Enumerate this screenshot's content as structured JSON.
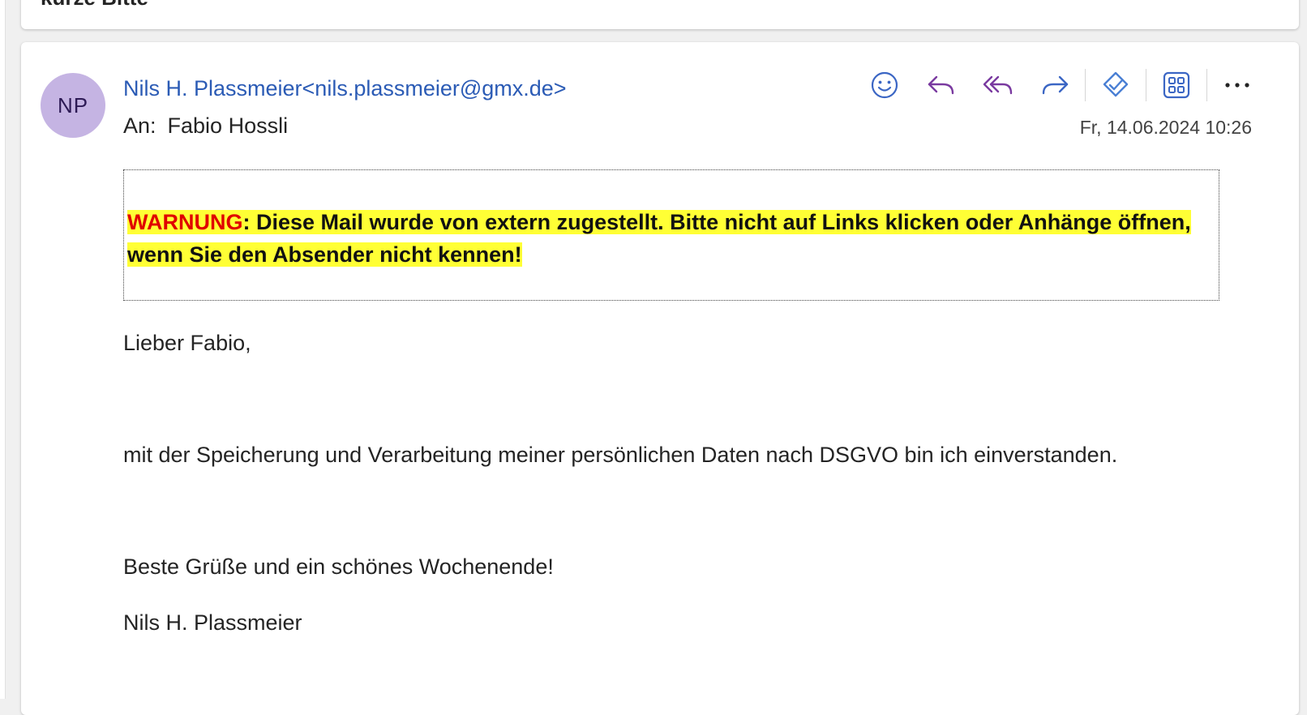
{
  "subject": "kurze Bitte",
  "message": {
    "avatar_initials": "NP",
    "sender": "Nils H. Plassmeier<nils.plassmeier@gmx.de>",
    "to_label": "An:",
    "to_name": "Fabio Hossli",
    "date": "Fr, 14.06.2024 10:26",
    "warning": {
      "keyword": "WARNUNG",
      "text": ": Diese Mail wurde von extern zugestellt. Bitte nicht auf Links klicken oder Anhänge öffnen, wenn Sie den Absender nicht kennen!"
    },
    "greeting": "Lieber Fabio,",
    "body": "mit der Speicherung und Verarbeitung meiner persönlichen Daten nach DSGVO bin ich einverstanden.",
    "closing": "Beste Grüße und ein schönes Wochenende!",
    "signature": "Nils H. Plassmeier"
  },
  "toolbar": {
    "icons": [
      "emoji-icon",
      "reply-icon",
      "reply-all-icon",
      "forward-icon",
      "viva-insights-icon",
      "apps-icon",
      "more-icon"
    ]
  },
  "colors": {
    "accent": "#2b5bb5",
    "avatar_bg": "#c5b4e3",
    "warning_highlight": "#ffff35",
    "warning_keyword": "#e00000",
    "reply_purple": "#7a3aa0"
  }
}
